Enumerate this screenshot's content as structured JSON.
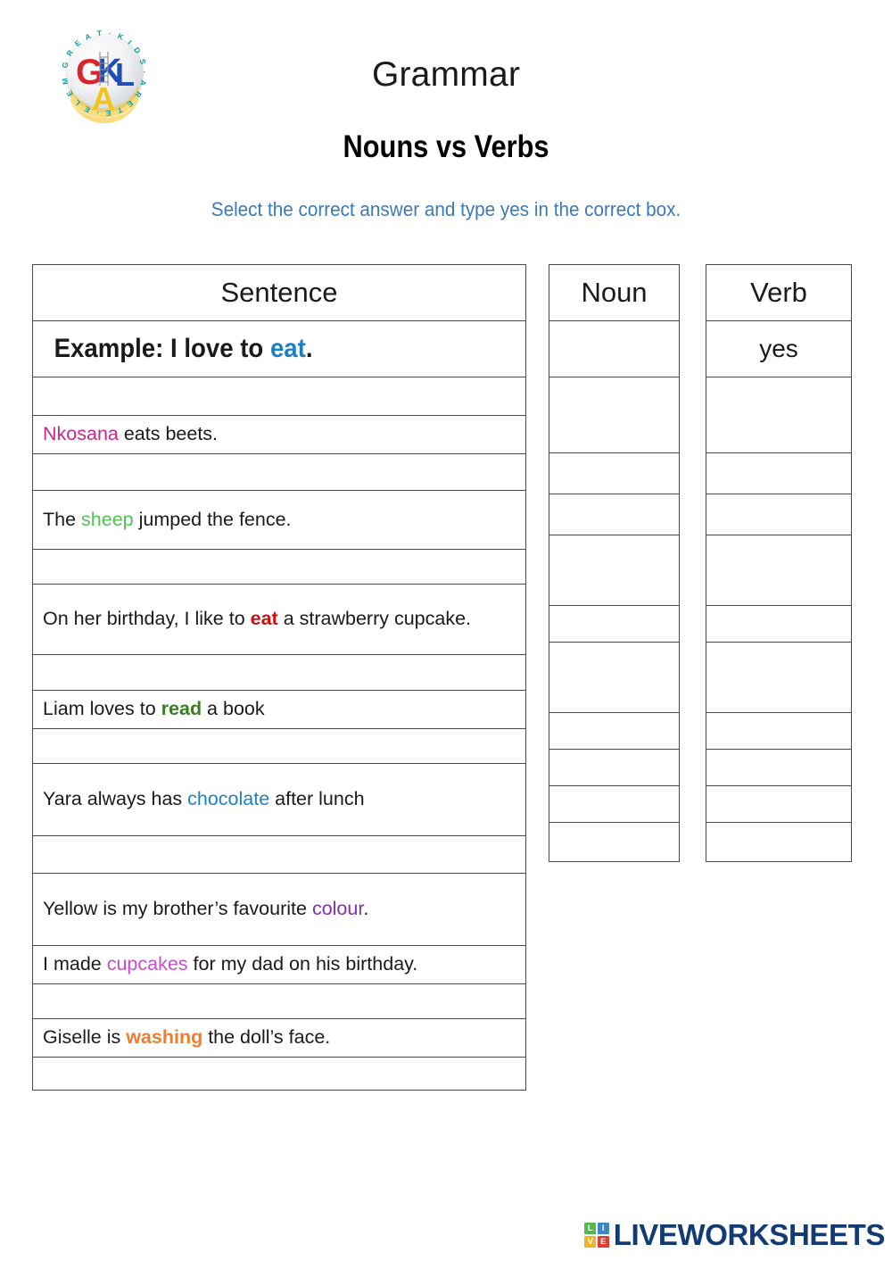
{
  "logo": {
    "name": "great-kids-arete-elementary-logo",
    "ring_text": "GREAT · KIDS · ARETE · ELEMENTARY",
    "letters": [
      "G",
      "K",
      "L",
      "A"
    ],
    "colors": {
      "g": "#d9262c",
      "k": "#1f4fb5",
      "l": "#1f4fb5",
      "a": "#f2c31a",
      "ring": "#0aa0a0"
    }
  },
  "header": {
    "title": "Grammar",
    "subtitle": "Nouns vs Verbs",
    "instructions": "Select the correct answer and type yes in the correct box.",
    "instructions_color": "#3a7ab8"
  },
  "table": {
    "headers": {
      "sentence": "Sentence",
      "noun": "Noun",
      "verb": "Verb"
    },
    "example": {
      "prefix": "Example: I love to ",
      "highlight": "eat",
      "highlight_color": "#1f7fc4",
      "suffix": ".",
      "noun_value": "",
      "verb_value": "yes"
    },
    "rows": [
      {
        "before": "",
        "highlight": "Nkosana",
        "highlight_color": "#c7278f",
        "after": " eats beets.",
        "noun_value": "",
        "verb_value": ""
      },
      {
        "before": "The ",
        "highlight": "sheep",
        "highlight_color": "#52c152",
        "after": " jumped the fence.",
        "noun_value": "",
        "verb_value": ""
      },
      {
        "before": "On her birthday, I like to ",
        "highlight": "eat",
        "highlight_color": "#cc1111",
        "after": " a strawberry cupcake.",
        "noun_value": "",
        "verb_value": ""
      },
      {
        "before": "Liam loves to ",
        "highlight": "read",
        "highlight_color": "#3a7d22",
        "after": " a book",
        "noun_value": "",
        "verb_value": ""
      },
      {
        "before": "Yara always has ",
        "highlight": "chocolate",
        "highlight_color": "#1f7fc4",
        "after": " after lunch",
        "noun_value": "",
        "verb_value": ""
      },
      {
        "before": "Yellow is my brother’s favourite ",
        "highlight": "colour",
        "highlight_color": "#8031a7",
        "after": ".",
        "noun_value": "",
        "verb_value": ""
      },
      {
        "before": "I made ",
        "highlight": "cupcakes",
        "highlight_color": "#c44fc9",
        "after": " for my dad on his birthday.",
        "noun_value": "",
        "verb_value": ""
      },
      {
        "before": "Giselle is ",
        "highlight": "washing",
        "highlight_color": "#ed7d31",
        "after": " the doll’s face.",
        "noun_value": "",
        "verb_value": ""
      }
    ]
  },
  "footer": {
    "brand": "LIVEWORKSHEETS",
    "brand_color": "#123a73",
    "tiles": [
      "L",
      "I",
      "V",
      "E"
    ]
  }
}
